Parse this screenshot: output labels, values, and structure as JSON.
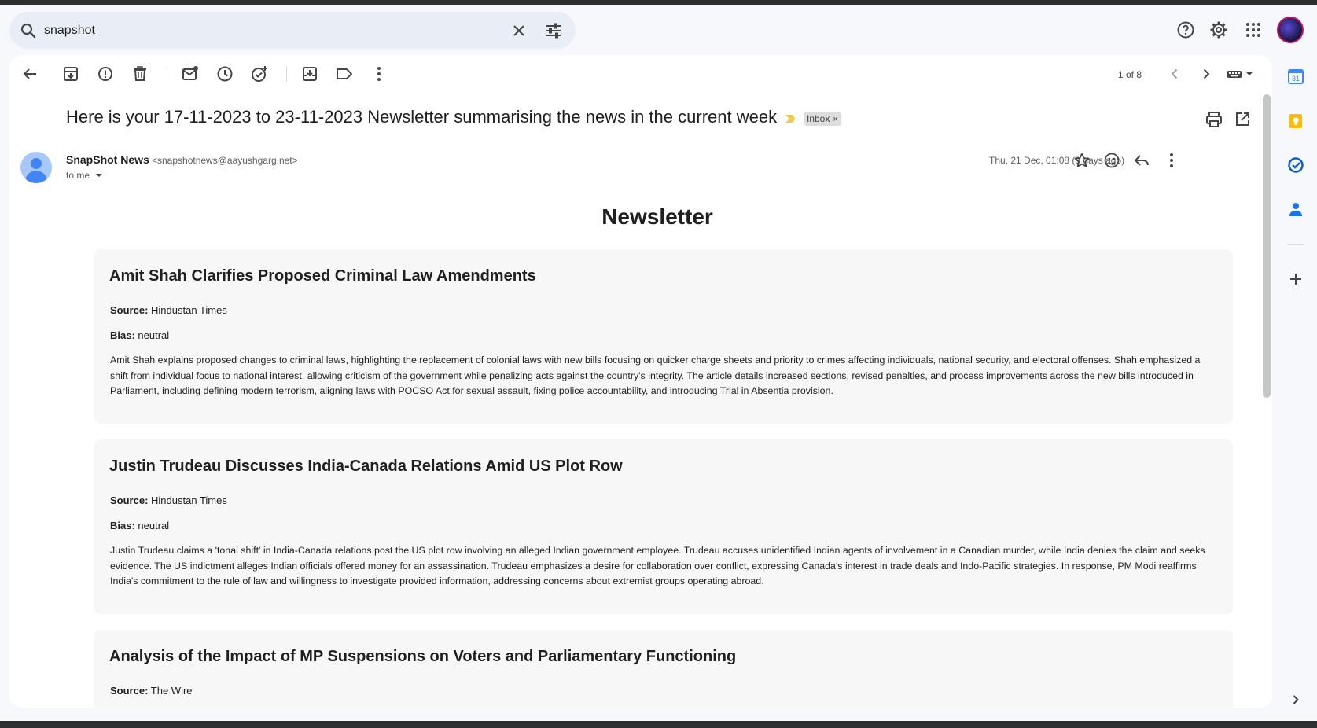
{
  "search": {
    "query": "snapshot"
  },
  "toolbar": {
    "pager": "1 of 8"
  },
  "email": {
    "subject": "Here is your 17-11-2023 to 23-11-2023 Newsletter summarising the news in the current week",
    "label": "Inbox",
    "label_close": "×",
    "sender_name": "SnapShot News",
    "sender_email": "<snapshotnews@aayushgarg.net>",
    "recipient": "to me",
    "date": "Thu, 21 Dec, 01:08 (3 days ago)"
  },
  "newsletter": {
    "title": "Newsletter",
    "source_label": "Source:",
    "bias_label": "Bias:",
    "articles": [
      {
        "headline": "Amit Shah Clarifies Proposed Criminal Law Amendments",
        "source": "Hindustan Times",
        "bias": "neutral",
        "summary": "Amit Shah explains proposed changes to criminal laws, highlighting the replacement of colonial laws with new bills focusing on quicker charge sheets and priority to crimes affecting individuals, national security, and electoral offenses. Shah emphasized a shift from individual focus to national interest, allowing criticism of the government while penalizing acts against the country's integrity. The article details increased sections, revised penalties, and process improvements across the new bills introduced in Parliament, including defining modern terrorism, aligning laws with POCSO Act for sexual assault, fixing police accountability, and introducing Trial in Absentia provision."
      },
      {
        "headline": "Justin Trudeau Discusses India-Canada Relations Amid US Plot Row",
        "source": "Hindustan Times",
        "bias": "neutral",
        "summary": "Justin Trudeau claims a 'tonal shift' in India-Canada relations post the US plot row involving an alleged Indian government employee. Trudeau accuses unidentified Indian agents of involvement in a Canadian murder, while India denies the claim and seeks evidence. The US indictment alleges Indian officials offered money for an assassination. Trudeau emphasizes a desire for collaboration over conflict, expressing Canada's interest in trade deals and Indo-Pacific strategies. In response, PM Modi reaffirms India's commitment to the rule of law and willingness to investigate provided information, addressing concerns about extremist groups operating abroad."
      },
      {
        "headline": "Analysis of the Impact of MP Suspensions on Voters and Parliamentary Functioning",
        "source": "The Wire"
      }
    ]
  },
  "colors": {
    "accent": "#0b57d0",
    "important_marker": "#f2c94c",
    "panel_bg": "#ffffff",
    "page_bg": "#f6f8fc"
  }
}
